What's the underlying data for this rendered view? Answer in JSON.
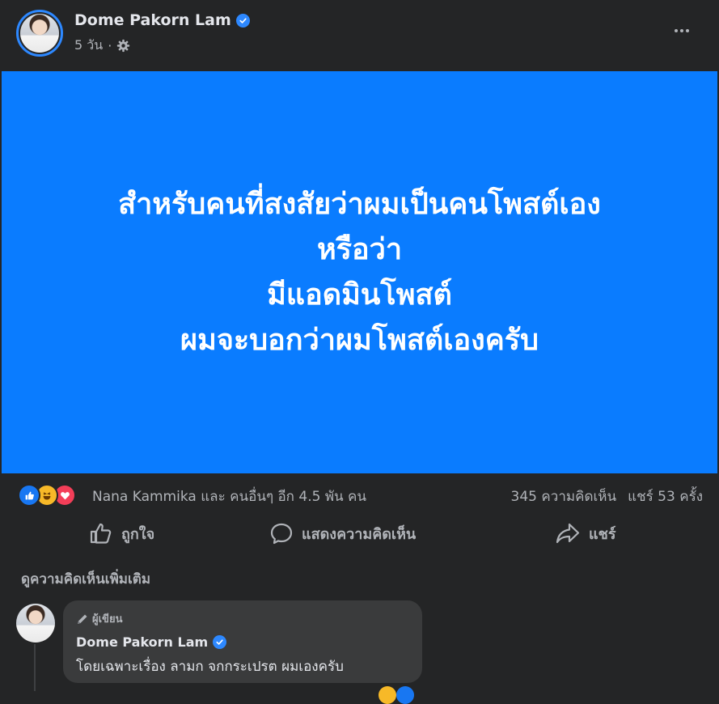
{
  "post": {
    "author": "Dome Pakorn Lam",
    "time": "5 วัน",
    "separator": "·",
    "icons": [
      "verified-badge-icon",
      "settings-gear-icon",
      "more-options-icon"
    ]
  },
  "image_text": {
    "lines": [
      "สำหรับคนที่สงสัยว่าผมเป็นคนโพสต์เอง",
      "หรือว่า",
      "มีแอดมินโพสต์",
      "ผมจะบอกว่าผมโพสต์เองครับ"
    ],
    "background_color": "#0a7cff"
  },
  "stats": {
    "reactions": [
      "like",
      "haha",
      "love"
    ],
    "reaction_summary": "Nana Kammika และ คนอื่นๆ อีก 4.5 พัน คน",
    "comments_count": "345 ความคิดเห็น",
    "shares_count": "แชร์ 53 ครั้ง"
  },
  "actions": {
    "like": "ถูกใจ",
    "comment": "แสดงความคิดเห็น",
    "share": "แชร์"
  },
  "comments": {
    "more_label": "ดูความคิดเห็นเพิ่มเติม",
    "items": [
      {
        "badge": "ผู้เขียน",
        "author": "Dome Pakorn Lam",
        "text": "โดยเฉพาะเรื่อง ลามก จกกระเปรต ผมเองครับ"
      }
    ]
  },
  "colors": {
    "background": "#242526",
    "accent": "#2d88ff",
    "muted_text": "#b0b3b8",
    "text": "#e4e6eb"
  }
}
